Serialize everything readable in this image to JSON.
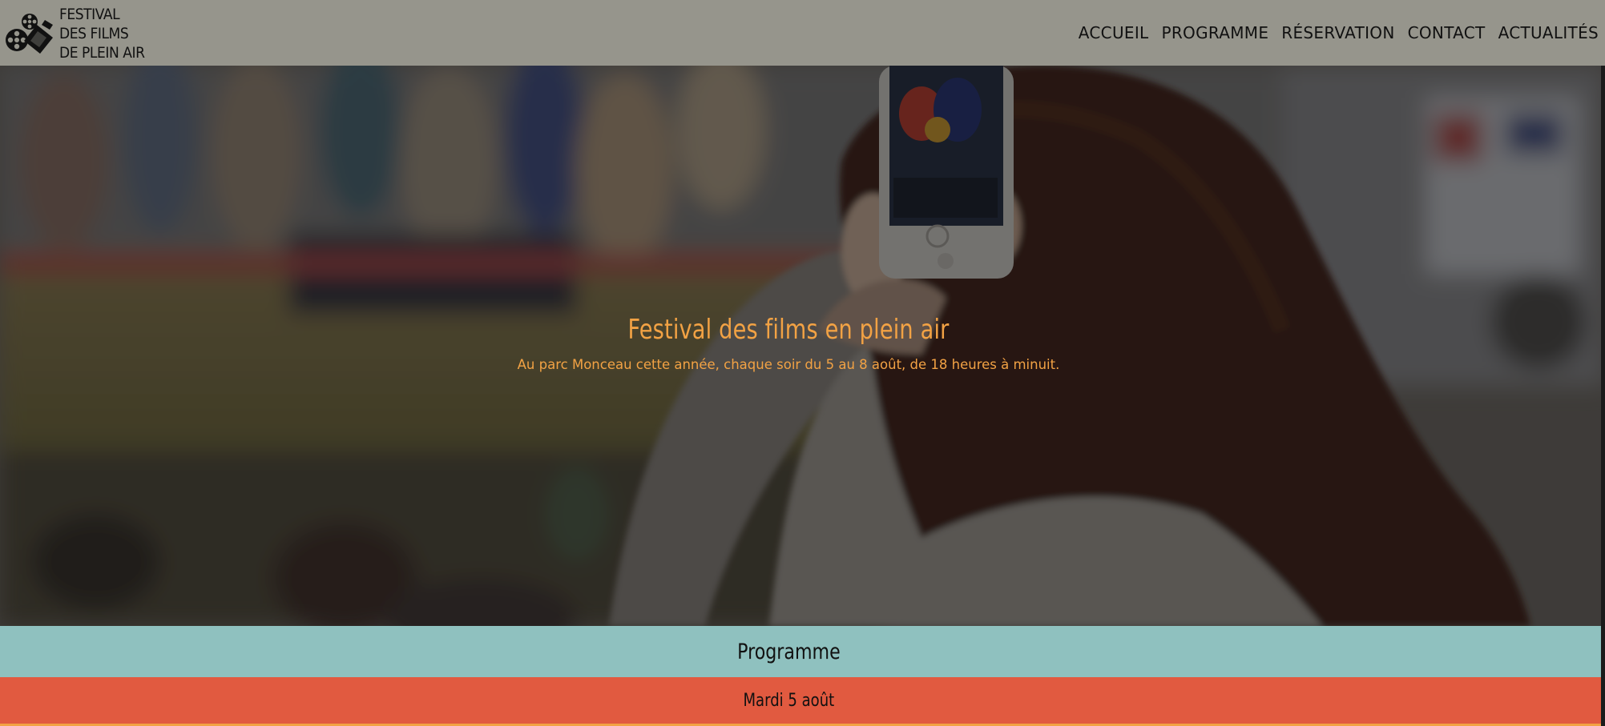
{
  "header": {
    "brand": {
      "line1": "FESTIVAL",
      "line2": "DES FILMS",
      "line3": "DE PLEIN AIR",
      "logo_icon": "film-reel-camera-icon"
    },
    "nav": [
      {
        "label": "ACCUEIL"
      },
      {
        "label": "PROGRAMME"
      },
      {
        "label": "RÉSERVATION"
      },
      {
        "label": "CONTACT"
      },
      {
        "label": "ACTUALITÉS"
      }
    ]
  },
  "hero": {
    "title": "Festival des films en plein air",
    "subtitle": "Au parc Monceau cette année, chaque soir du 5 au 8 août, de 18 heures à minuit."
  },
  "programme": {
    "title": "Programme"
  },
  "day": {
    "title": "Mardi 5 août"
  },
  "colors": {
    "header_bg": "#96958c",
    "accent_orange": "#f2a244",
    "programme_bg": "#8fc1bf",
    "day_bg": "#e15a40"
  }
}
